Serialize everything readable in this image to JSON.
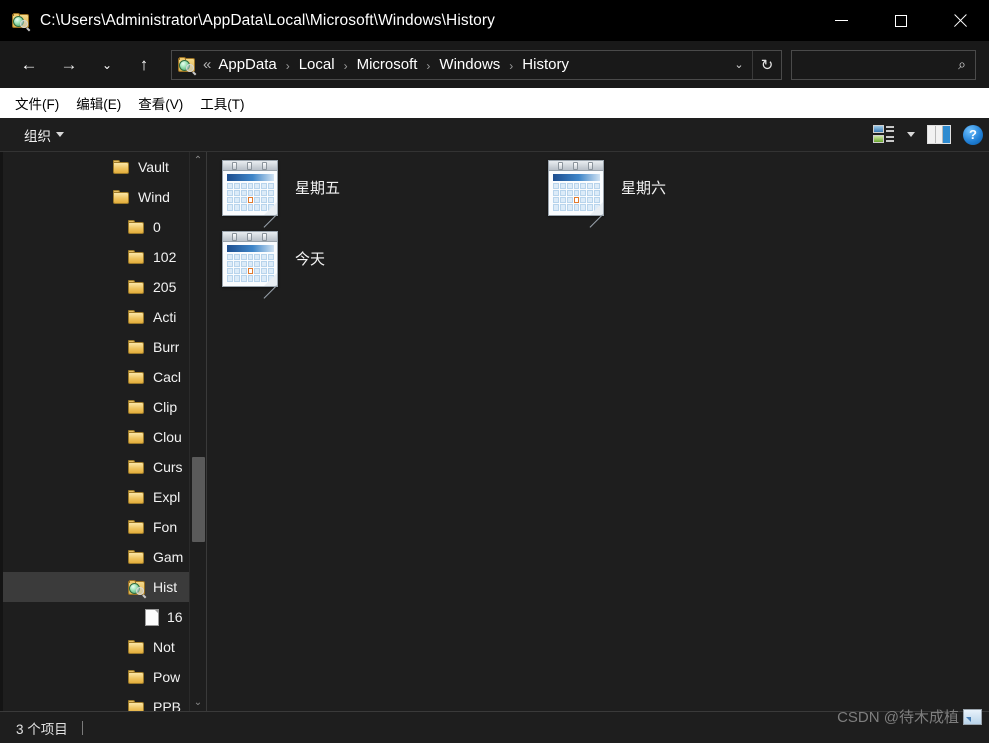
{
  "window": {
    "title": "C:\\Users\\Administrator\\AppData\\Local\\Microsoft\\Windows\\History",
    "title_icon": "history-folder-icon",
    "controls": {
      "minimize": "—",
      "maximize": "☐",
      "close": "×"
    }
  },
  "nav": {
    "back_icon": "←",
    "forward_icon": "→",
    "recent_icon": "⌄",
    "up_icon": "↑",
    "address_icon": "history-folder-icon",
    "ellipsis": "«",
    "separator": "›",
    "breadcrumbs": [
      {
        "label": "AppData"
      },
      {
        "label": "Local"
      },
      {
        "label": "Microsoft"
      },
      {
        "label": "Windows"
      },
      {
        "label": "History"
      }
    ],
    "dropdown_icon": "⌄",
    "refresh_icon": "↻"
  },
  "search": {
    "value": "",
    "placeholder": "",
    "icon": "⌕"
  },
  "menubar": {
    "items": [
      {
        "label": "文件(F)"
      },
      {
        "label": "编辑(E)"
      },
      {
        "label": "查看(V)"
      },
      {
        "label": "工具(T)"
      }
    ]
  },
  "toolbar": {
    "organize_label": "组织",
    "view_mode_icon": "view-mode-icon",
    "view_mode_caret": "▾",
    "preview_pane_icon": "preview-pane-icon",
    "help_icon": "?"
  },
  "sidebar": {
    "scroll_up_icon": "⌃",
    "scroll_down_icon": "⌄",
    "items": [
      {
        "label": "Vault",
        "icon": "folder-icon",
        "indent": 0,
        "selected": false
      },
      {
        "label": "Wind",
        "icon": "folder-icon",
        "indent": 0,
        "selected": false
      },
      {
        "label": "0",
        "icon": "folder-icon",
        "indent": 1,
        "selected": false
      },
      {
        "label": "102",
        "icon": "folder-icon",
        "indent": 1,
        "selected": false
      },
      {
        "label": "205",
        "icon": "folder-icon",
        "indent": 1,
        "selected": false
      },
      {
        "label": "Acti",
        "icon": "folder-icon",
        "indent": 1,
        "selected": false
      },
      {
        "label": "Burr",
        "icon": "folder-icon",
        "indent": 1,
        "selected": false
      },
      {
        "label": "Cacl",
        "icon": "folder-icon",
        "indent": 1,
        "selected": false
      },
      {
        "label": "Clip",
        "icon": "folder-icon",
        "indent": 1,
        "selected": false
      },
      {
        "label": "Clou",
        "icon": "folder-icon",
        "indent": 1,
        "selected": false
      },
      {
        "label": "Curs",
        "icon": "folder-icon",
        "indent": 1,
        "selected": false
      },
      {
        "label": "Expl",
        "icon": "folder-icon",
        "indent": 1,
        "selected": false
      },
      {
        "label": "Fon",
        "icon": "folder-icon",
        "indent": 1,
        "selected": false
      },
      {
        "label": "Gam",
        "icon": "folder-icon",
        "indent": 1,
        "selected": false
      },
      {
        "label": "Hist",
        "icon": "history-folder-icon",
        "indent": 1,
        "selected": true
      },
      {
        "label": "16",
        "icon": "file-icon",
        "indent": 2,
        "selected": false
      },
      {
        "label": "Not",
        "icon": "folder-icon",
        "indent": 1,
        "selected": false
      },
      {
        "label": "Pow",
        "icon": "folder-icon",
        "indent": 1,
        "selected": false
      },
      {
        "label": "PPB",
        "icon": "folder-icon",
        "indent": 1,
        "selected": false
      }
    ]
  },
  "content": {
    "items": [
      {
        "label": "星期五",
        "icon": "calendar-icon"
      },
      {
        "label": "星期六",
        "icon": "calendar-icon"
      },
      {
        "label": "今天",
        "icon": "calendar-icon"
      }
    ]
  },
  "statusbar": {
    "item_count_text": "3 个项目"
  },
  "watermark": {
    "text": "CSDN @待木成植",
    "badge_icon": "image-badge-icon"
  },
  "colors": {
    "window_bg": "#1e1e1e",
    "titlebar_bg": "#000000",
    "navbar_bg": "#191919",
    "menubar_bg": "#ffffff",
    "selection_bg": "#3b3b3b",
    "text": "#f2f2f2",
    "border": "#3a3a3a",
    "accent_folder": "#eec460",
    "calendar_highlight": "#e07a30"
  }
}
